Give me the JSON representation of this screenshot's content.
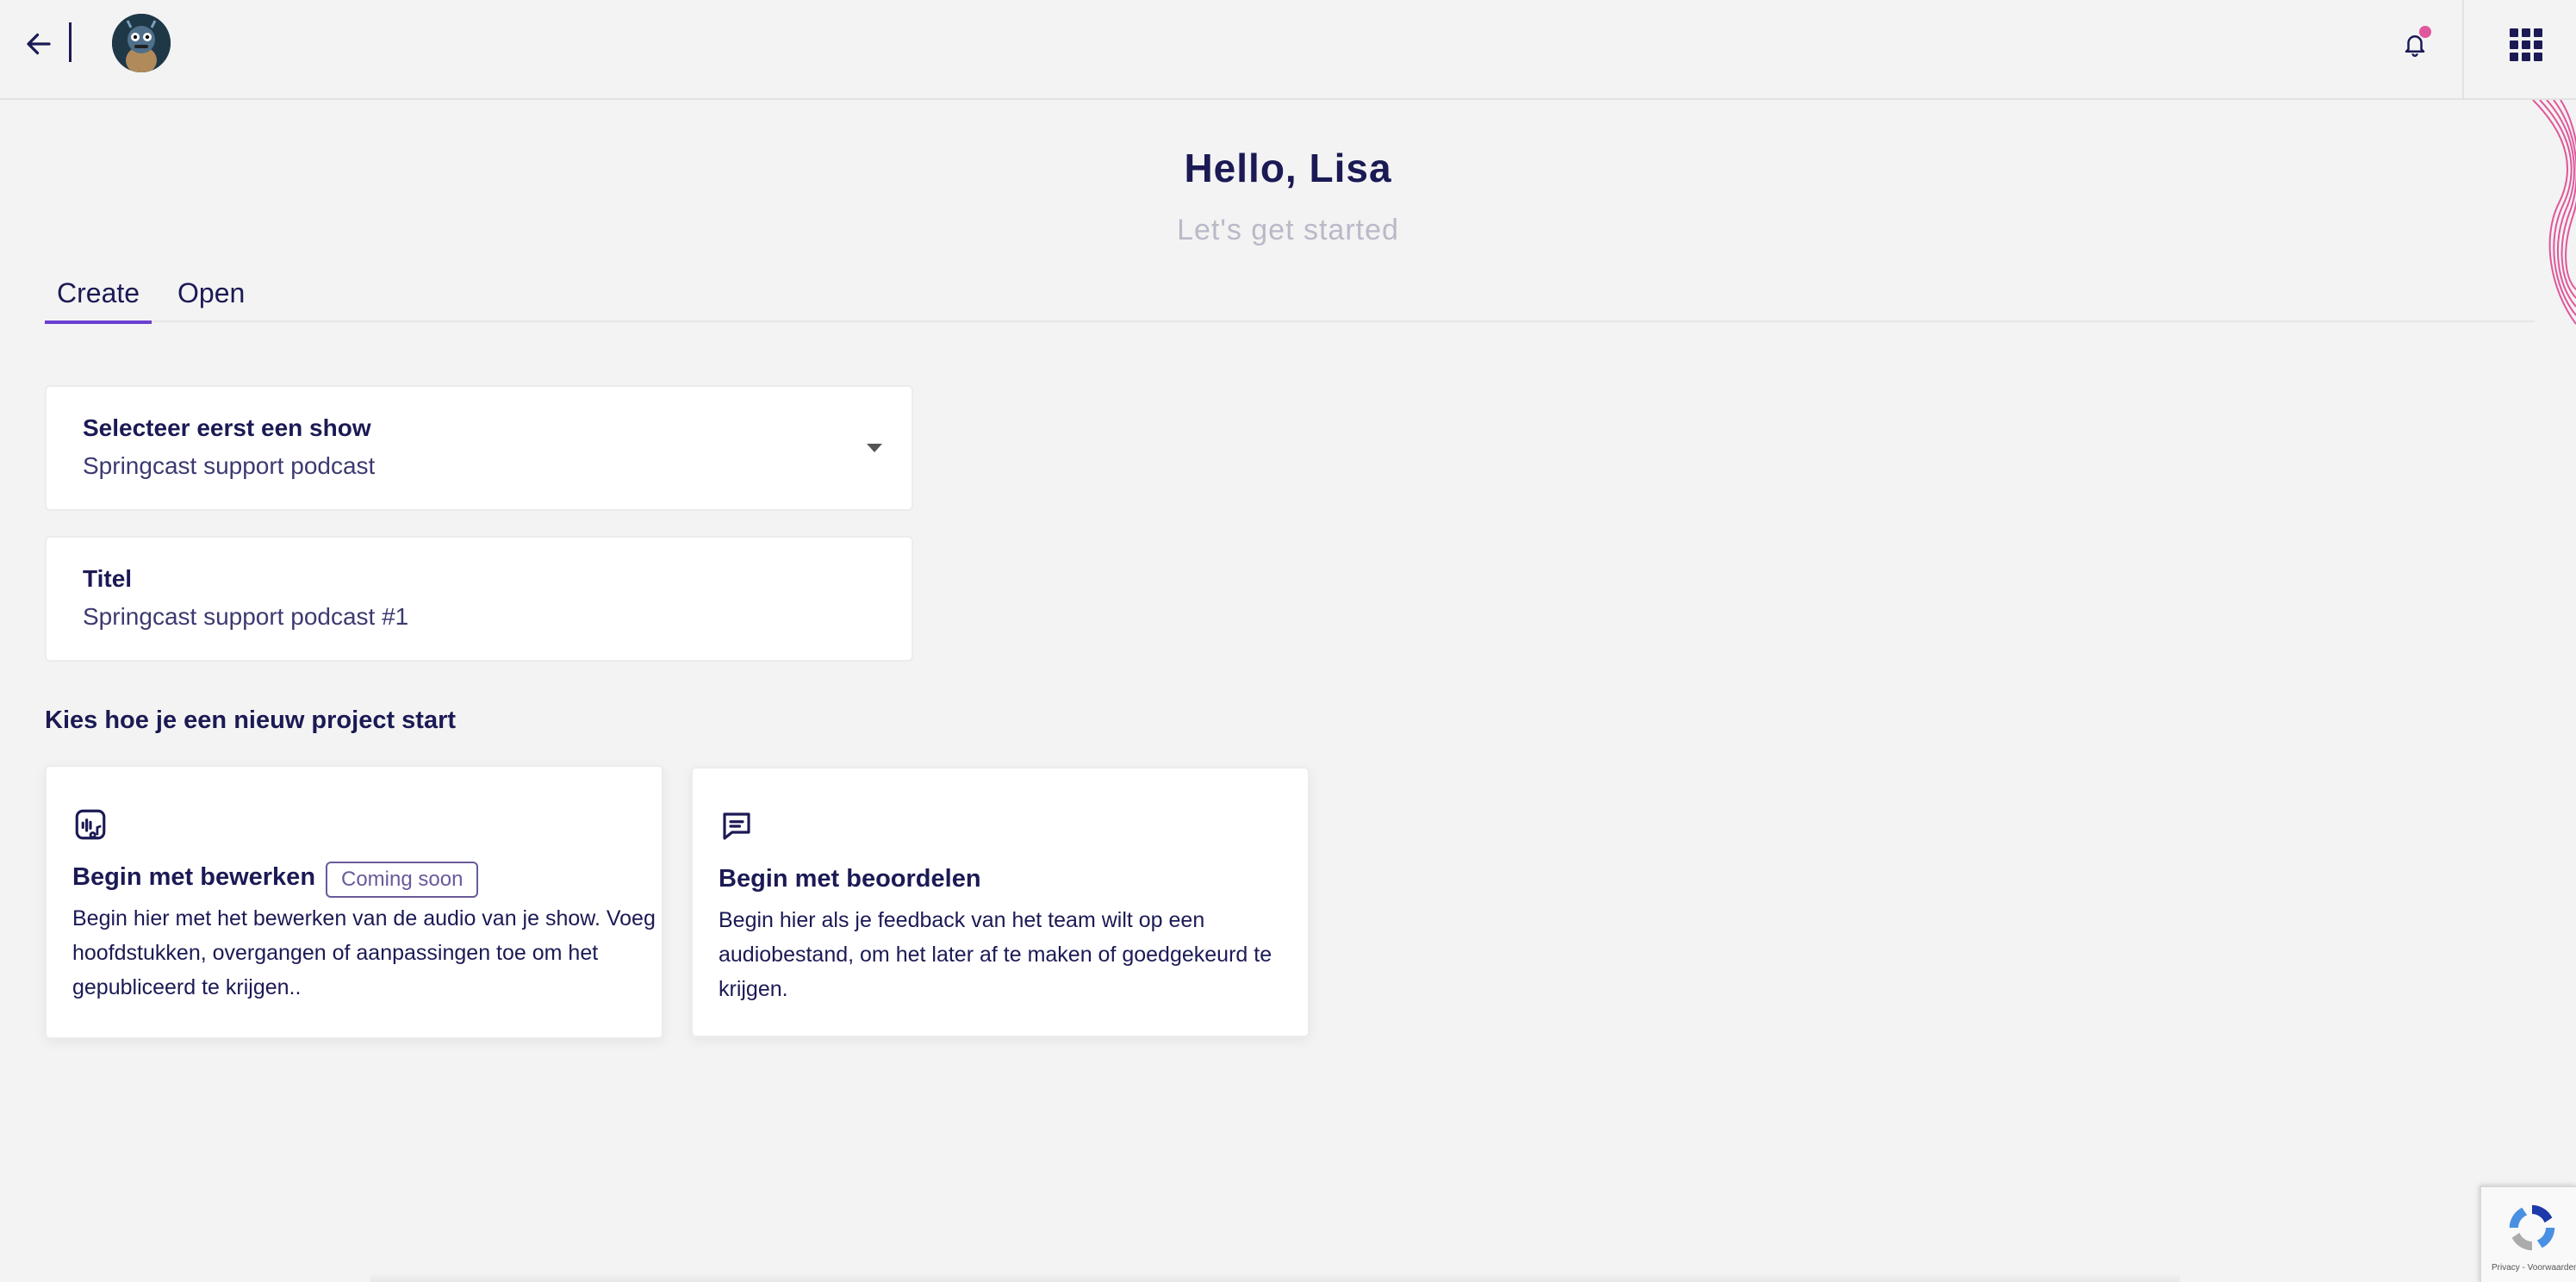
{
  "header": {
    "back_icon": "arrow-left-icon",
    "avatar_icon": "user-avatar",
    "notification_icon": "bell-icon",
    "apps_icon": "grid-apps-icon",
    "notification_dot_color": "#e0579b"
  },
  "greeting": {
    "title": "Hello, Lisa",
    "subtitle": "Let's get started"
  },
  "tabs": [
    {
      "label": "Create",
      "active": true
    },
    {
      "label": "Open",
      "active": false
    }
  ],
  "form": {
    "show_select": {
      "label": "Selecteer eerst een show",
      "value": "Springcast support podcast"
    },
    "title_field": {
      "label": "Titel",
      "value": "Springcast support podcast #1"
    }
  },
  "project_section": {
    "heading": "Kies hoe je een nieuw project start",
    "cards": [
      {
        "icon": "audio-edit-icon",
        "title": "Begin met bewerken",
        "badge": "Coming soon",
        "description": "Begin hier met het bewerken van de audio van je show. Voeg hoofdstukken, overgangen of aanpassingen toe om het gepubliceerd te krijgen.."
      },
      {
        "icon": "chat-message-icon",
        "title": "Begin met beoordelen",
        "description": "Begin hier als je feedback van het team wilt op een audiobestand, om het later af te maken of goedgekeurd te krijgen."
      }
    ]
  },
  "recaptcha": {
    "footer": "Privacy - Voorwaarden"
  },
  "colors": {
    "primary_text": "#1b1a55",
    "accent": "#6a3fd0",
    "subtitle": "#b9b9c8",
    "wave": "#e0579b"
  }
}
